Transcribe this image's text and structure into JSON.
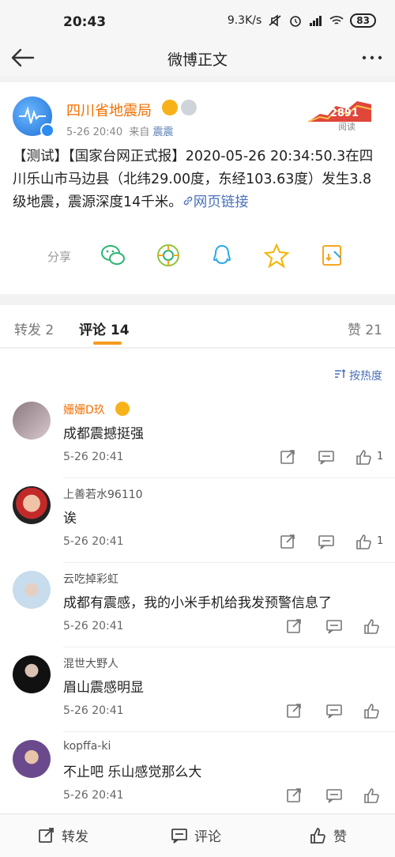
{
  "status_bar": {
    "time": "20:43",
    "network_speed": "9.3K/s",
    "battery": "83",
    "icons": [
      "mute-icon",
      "alarm-icon",
      "signal-icon",
      "wifi-icon"
    ]
  },
  "nav": {
    "title": "微博正文",
    "back_icon": "arrow-left-icon",
    "more_icon": "more-dots-icon"
  },
  "post": {
    "author": "四川省地震局",
    "time": "5-26 20:40",
    "source_prefix": "来自",
    "source": "震震",
    "readers_count": "2891",
    "readers_label": "阅读",
    "text": "【测试】【国家台网正式报】2020-05-26 20:34:50.3在四川乐山市马边县（北纬29.00度，东经103.63度）发生3.8级地震，震源深度14千米。",
    "link_text": "网页链接",
    "share_label": "分享",
    "share_targets": [
      "wechat-icon",
      "moments-icon",
      "qq-icon",
      "qzone-icon",
      "save-image-icon"
    ]
  },
  "tabs": {
    "repost": "转发 2",
    "comment": "评论 14",
    "like": "赞 21"
  },
  "sort_label": "按热度",
  "comments": [
    {
      "name": "姗姗D玖",
      "text": "成都震撼挺强",
      "time": "5-26 20:41",
      "likes": "1"
    },
    {
      "name": "上善若水96110",
      "text": "诶",
      "time": "5-26 20:41",
      "likes": "1"
    },
    {
      "name": "云吃掉彩虹",
      "text": "成都有震感，我的小米手机给我发预警信息了",
      "time": "5-26 20:41",
      "likes": ""
    },
    {
      "name": "混世大野人",
      "text": "眉山震感明显",
      "time": "5-26 20:41",
      "likes": ""
    },
    {
      "name": "kopffa-ki",
      "text": "不止吧 乐山感觉那么大",
      "time": "5-26 20:41",
      "likes": ""
    }
  ],
  "bottom_bar": {
    "repost": "转发",
    "comment": "评论",
    "like": "赞"
  },
  "colors": {
    "accent_orange": "#f26f00",
    "link_blue": "#4a72b8",
    "tab_underline": "#f59b22"
  }
}
